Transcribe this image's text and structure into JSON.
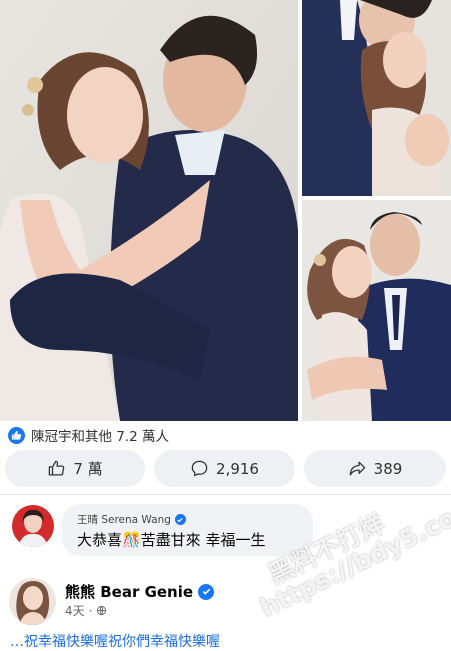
{
  "photos": [
    {
      "name": "main-photo",
      "icon": "wedding-couple-photo"
    },
    {
      "name": "photo-top-right",
      "icon": "wedding-kiss-photo"
    },
    {
      "name": "photo-bottom-right",
      "icon": "wedding-nose-touch-photo"
    }
  ],
  "reactions": {
    "icon": "like-icon",
    "text": "陳冠宇和其他 7.2 萬人"
  },
  "actions": {
    "like_count": "7 萬",
    "comment_count": "2,916",
    "share_count": "389"
  },
  "comments": [
    {
      "author": "王晴 Serena Wang",
      "verified": true,
      "text": "大恭喜🎊苦盡甘來 幸福一生"
    },
    {
      "author": "熊熊 Bear Genie",
      "verified": true,
      "time": "4天",
      "audience_icon": "globe-icon",
      "text_partial": "…祝幸福快樂喔祝你們幸福快樂喔"
    }
  ],
  "watermark": {
    "line1": "黑料不打烊",
    "line2": "https://bdy5.co"
  },
  "colors": {
    "brand_blue": "#1877f2",
    "pill_bg": "#eef0f3",
    "bubble_bg": "#f0f2f5"
  }
}
